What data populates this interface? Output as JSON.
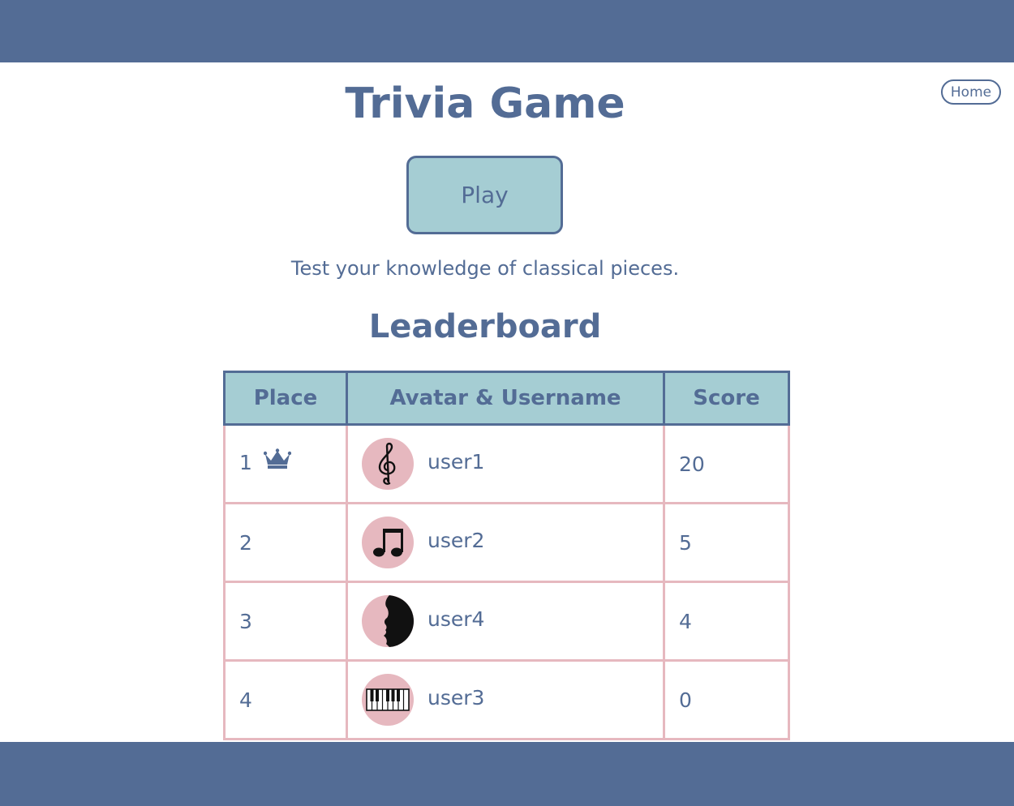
{
  "header": {
    "home_label": "Home"
  },
  "page": {
    "title": "Trivia Game",
    "play_label": "Play",
    "tagline": "Test your knowledge of classical pieces.",
    "leaderboard_title": "Leaderboard"
  },
  "table": {
    "headers": [
      "Place",
      "Avatar & Username",
      "Score"
    ],
    "rows": [
      {
        "place": "1",
        "badge": "crown-icon",
        "avatar": "treble-clef-icon",
        "username": "user1",
        "score": "20"
      },
      {
        "place": "2",
        "avatar": "beamed-notes-icon",
        "username": "user2",
        "score": "5"
      },
      {
        "place": "3",
        "avatar": "composer-silhouette-icon",
        "username": "user4",
        "score": "4"
      },
      {
        "place": "4",
        "avatar": "piano-keys-icon",
        "username": "user3",
        "score": "0"
      }
    ]
  },
  "colors": {
    "primary": "#536c95",
    "accent": "#a5cdd3",
    "pink": "#e6b8bf",
    "background": "#ffffff"
  }
}
